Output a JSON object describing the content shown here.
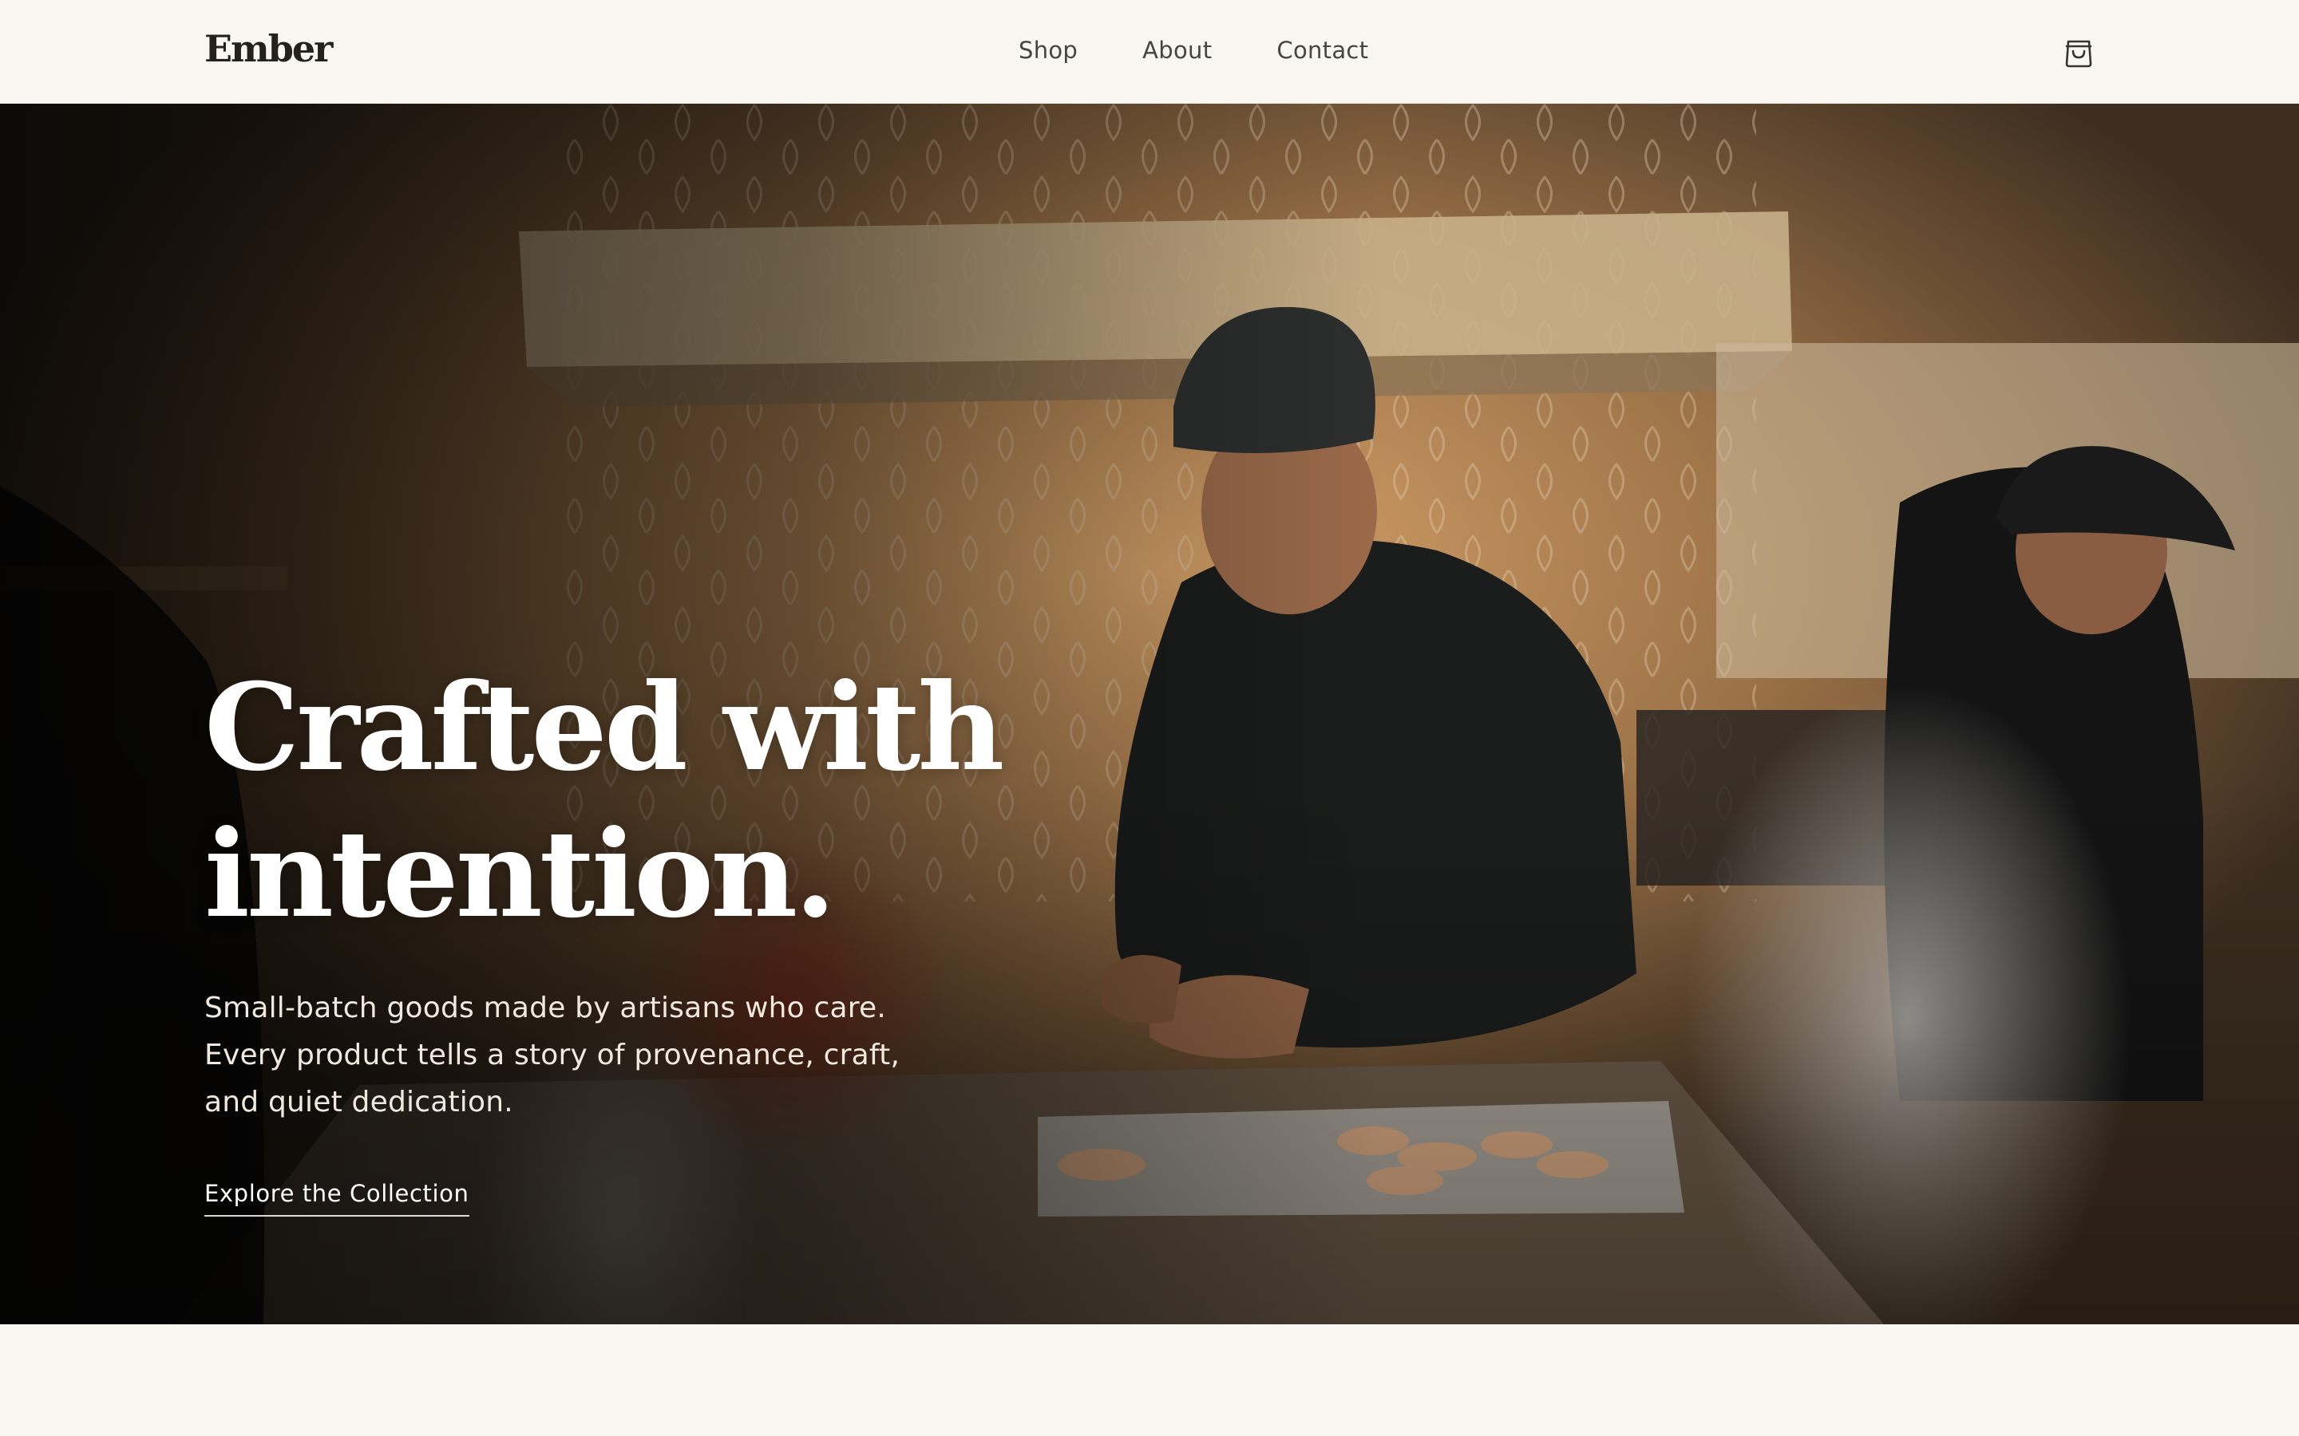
{
  "brand": {
    "name": "Ember"
  },
  "nav": {
    "links": [
      {
        "label": "Shop"
      },
      {
        "label": "About"
      },
      {
        "label": "Contact"
      }
    ],
    "cart_icon": "shopping-bag-icon"
  },
  "hero": {
    "title_line1": "Crafted with",
    "title_line2": "intention.",
    "subtitle": "Small-batch goods made by artisans who care. Every product tells a story of provenance, craft, and quiet dedication.",
    "cta_label": "Explore the Collection",
    "image_subject": "chef-in-kitchen-photo"
  },
  "colors": {
    "background": "#faf7f2",
    "text_dark": "#25211d",
    "hero_text": "#ffffff"
  }
}
